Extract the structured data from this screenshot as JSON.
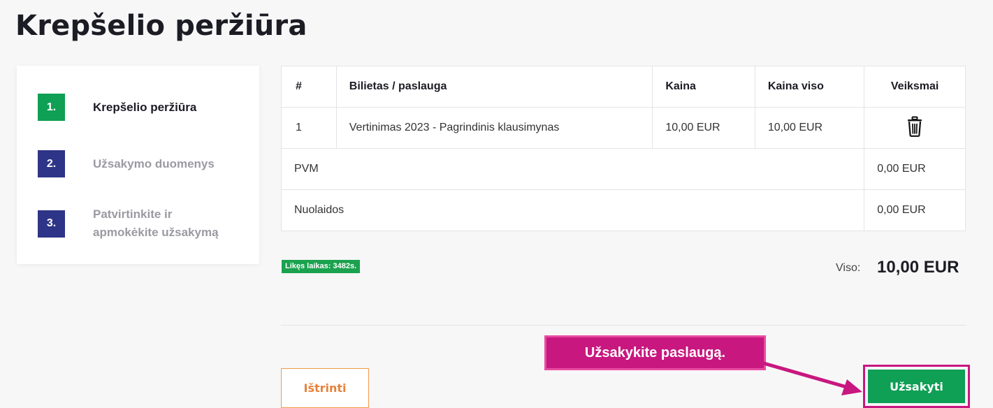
{
  "page": {
    "title": "Krepšelio peržiūra"
  },
  "steps": [
    {
      "number": "1.",
      "label": "Krepšelio peržiūra",
      "state": "active"
    },
    {
      "number": "2.",
      "label": "Užsakymo duomenys",
      "state": "pending"
    },
    {
      "number": "3.",
      "label": "Patvirtinkite ir apmokėkite užsakymą",
      "state": "pending"
    }
  ],
  "cart": {
    "headers": {
      "num": "#",
      "item": "Bilietas / paslauga",
      "price": "Kaina",
      "total": "Kaina viso",
      "actions": "Veiksmai"
    },
    "rows": [
      {
        "num": "1",
        "item": "Vertinimas 2023 - Pagrindinis klausimynas",
        "price": "10,00 EUR",
        "total": "10,00 EUR",
        "action_icon": "trash-icon"
      }
    ],
    "vat": {
      "label": "PVM",
      "value": "0,00 EUR"
    },
    "discounts": {
      "label": "Nuolaidos",
      "value": "0,00 EUR"
    }
  },
  "timer": {
    "text": "Likęs laikas: 3482s."
  },
  "summary": {
    "label": "Viso:",
    "value": "10,00 EUR"
  },
  "buttons": {
    "delete": "Ištrinti",
    "order": "Užsakyti"
  },
  "callout": {
    "text": "Užsakykite paslaugą."
  },
  "colors": {
    "accent_green": "#0f9f55",
    "step_blue": "#2e3487",
    "highlight_magenta": "#c8177f",
    "delete_orange": "#e8823a"
  }
}
